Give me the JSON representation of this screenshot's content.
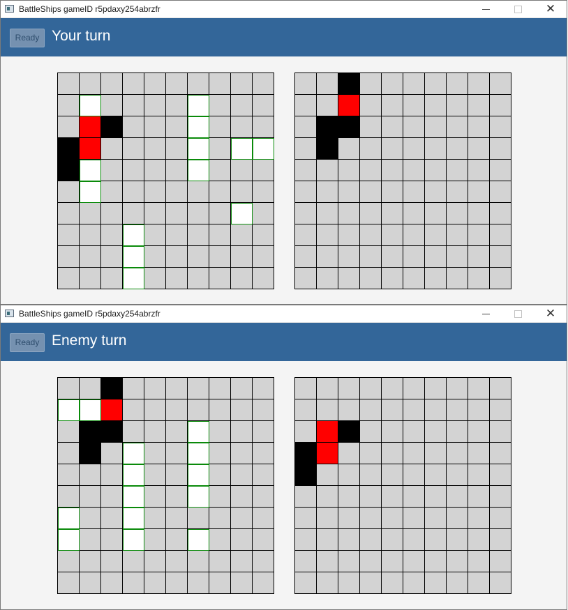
{
  "windows": [
    {
      "title": "BattleShips gameID r5pdaxy254abrzfr",
      "ready_label": "Ready",
      "turn_text": "Your turn",
      "own_board": [
        "..........",
        ".S....S...",
        ".HM...S...",
        "MH....S.SS",
        "MS....S...",
        ".S........",
        "........S.",
        "...S......",
        "...S......",
        "...S......"
      ],
      "enemy_board": [
        "..M.......",
        "..H.......",
        ".MM.......",
        ".M........",
        "..........",
        "..........",
        "..........",
        "..........",
        "..........",
        ".........."
      ]
    },
    {
      "title": "BattleShips gameID r5pdaxy254abrzfr",
      "ready_label": "Ready",
      "turn_text": "Enemy turn",
      "own_board": [
        "..M.......",
        "SSH.......",
        ".MM...S...",
        ".M.S..S...",
        "...S..S...",
        "...S..S...",
        "S..S......",
        "S..S..S...",
        "..........",
        ".........."
      ],
      "enemy_board": [
        "..........",
        "..........",
        ".HM.......",
        "MH........",
        "M.........",
        "..........",
        "..........",
        "..........",
        "..........",
        ".........."
      ]
    }
  ],
  "legend": {
    "S": "ship",
    "H": "hit",
    "M": "miss",
    ".": "empty"
  },
  "colors": {
    "header": "#336699",
    "cell_empty": "#d3d3d3",
    "cell_ship": "#ffffff",
    "cell_hit": "#ff0000",
    "cell_miss": "#000000",
    "ship_border": "#0a8a0a"
  }
}
